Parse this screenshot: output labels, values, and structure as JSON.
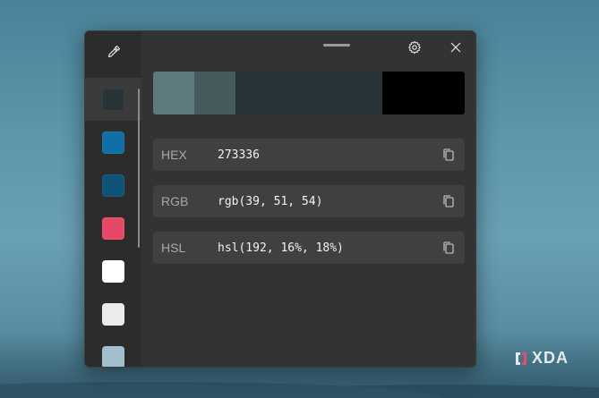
{
  "window": {
    "icons": {
      "picker": "color-picker-icon",
      "settings": "gear-icon",
      "close": "close-icon",
      "copy": "copy-icon"
    },
    "history": [
      {
        "color": "#273336",
        "selected": true
      },
      {
        "color": "#0f6fa6",
        "selected": false
      },
      {
        "color": "#0f5478",
        "selected": false
      },
      {
        "color": "#e54967",
        "selected": false
      },
      {
        "color": "#ffffff",
        "selected": false
      },
      {
        "color": "#ebebeb",
        "selected": false
      },
      {
        "color": "#a3bfcb",
        "selected": false
      }
    ],
    "shades": [
      {
        "color": "#5f7a7f",
        "main": false
      },
      {
        "color": "#475b5e",
        "main": false
      },
      {
        "color": "#273336",
        "main": true
      },
      {
        "color": "#000000",
        "main": false
      },
      {
        "color": "#000000",
        "main": false
      }
    ],
    "formats": [
      {
        "label": "HEX",
        "value": "273336"
      },
      {
        "label": "RGB",
        "value": "rgb(39, 51, 54)"
      },
      {
        "label": "HSL",
        "value": "hsl(192, 16%, 18%)"
      }
    ]
  },
  "watermark": {
    "text": "XDA",
    "icon": "xda-logo-icon"
  }
}
